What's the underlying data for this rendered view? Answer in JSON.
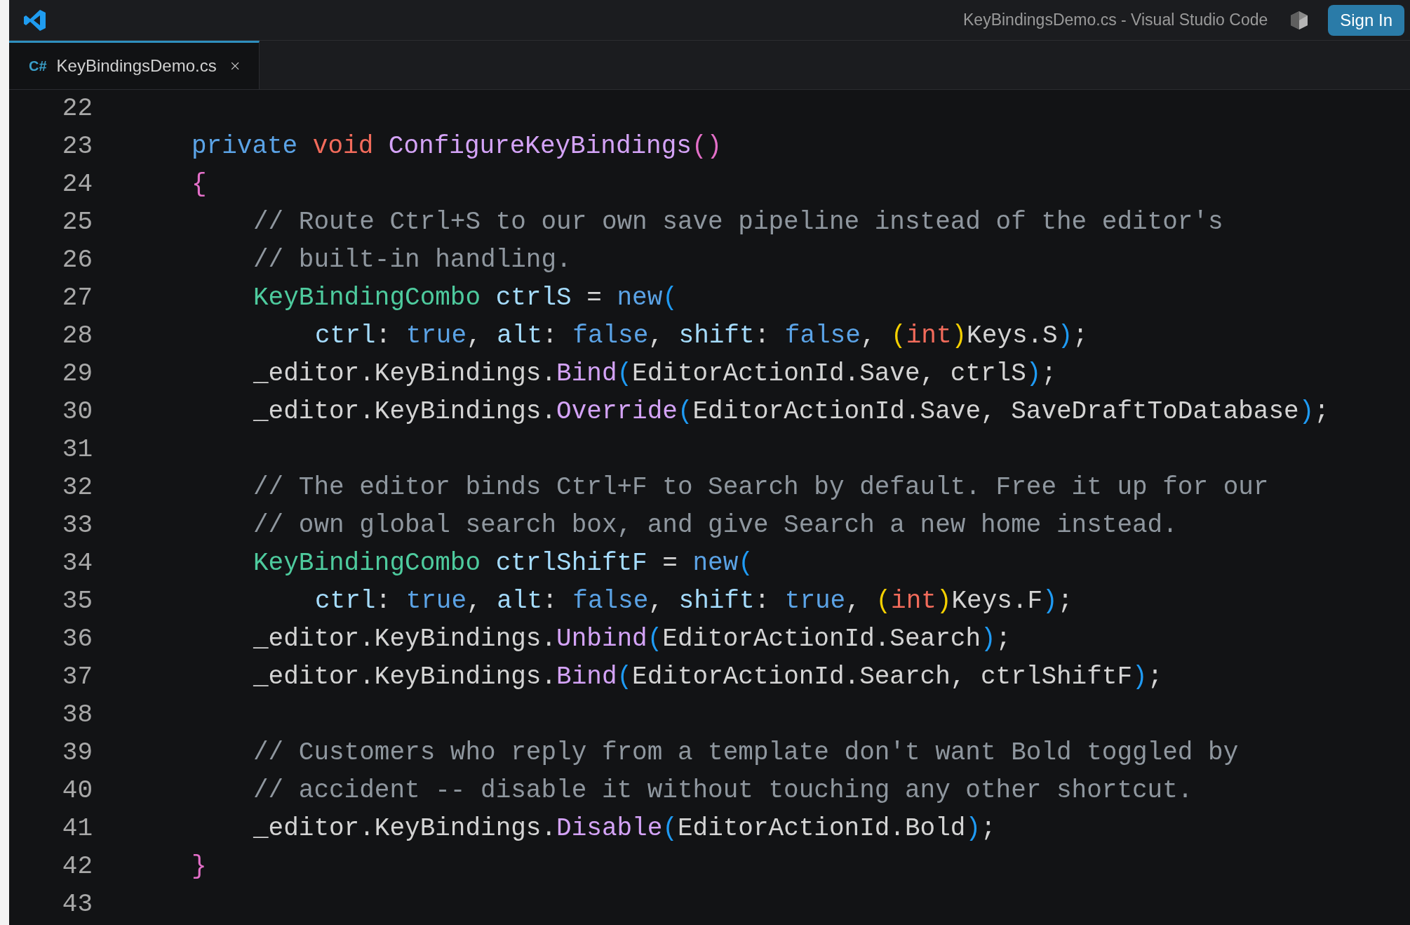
{
  "window": {
    "title": "KeyBindingsDemo.cs - Visual Studio Code",
    "sign_in": "Sign In"
  },
  "tabs": [
    {
      "label": "KeyBindingsDemo.cs",
      "icon": "C#",
      "selected": true
    }
  ],
  "editor": {
    "lines": [
      {
        "number": "22",
        "kind": "blank"
      },
      {
        "number": "23",
        "kind": "member",
        "tokens": [
          {
            "kind": "kw",
            "text": "private "
          },
          {
            "kind": "kw2",
            "text": "void "
          },
          {
            "kind": "fn",
            "text": "ConfigureKeyBindings"
          },
          {
            "kind": "b1",
            "text": "()"
          }
        ]
      },
      {
        "number": "24",
        "kind": "member",
        "tokens": [
          {
            "kind": "b1",
            "text": "{"
          }
        ]
      },
      {
        "number": "25",
        "kind": "body",
        "tokens": [
          {
            "kind": "comment",
            "text": "// Route Ctrl+S to our own save pipeline instead of the editor's"
          }
        ]
      },
      {
        "number": "26",
        "kind": "body",
        "tokens": [
          {
            "kind": "comment",
            "text": "// built-in handling."
          }
        ]
      },
      {
        "number": "27",
        "kind": "body",
        "tokens": [
          {
            "kind": "type",
            "text": "KeyBindingCombo "
          },
          {
            "kind": "var",
            "text": "ctrlS"
          },
          {
            "kind": "plain",
            "text": " = "
          },
          {
            "kind": "kw",
            "text": "new"
          },
          {
            "kind": "b2",
            "text": "("
          }
        ]
      },
      {
        "number": "28",
        "kind": "continuation",
        "tokens": [
          {
            "kind": "var",
            "text": "ctrl"
          },
          {
            "kind": "plain",
            "text": ": "
          },
          {
            "kind": "kw",
            "text": "true"
          },
          {
            "kind": "plain",
            "text": ", "
          },
          {
            "kind": "var",
            "text": "alt"
          },
          {
            "kind": "plain",
            "text": ": "
          },
          {
            "kind": "kw",
            "text": "false"
          },
          {
            "kind": "plain",
            "text": ", "
          },
          {
            "kind": "var",
            "text": "shift"
          },
          {
            "kind": "plain",
            "text": ": "
          },
          {
            "kind": "kw",
            "text": "false"
          },
          {
            "kind": "plain",
            "text": ", "
          },
          {
            "kind": "b3",
            "text": "("
          },
          {
            "kind": "kw2",
            "text": "int"
          },
          {
            "kind": "b3",
            "text": ")"
          },
          {
            "kind": "plain",
            "text": "Keys.S"
          },
          {
            "kind": "b2",
            "text": ")"
          },
          {
            "kind": "plain",
            "text": ";"
          }
        ]
      },
      {
        "number": "29",
        "kind": "body",
        "tokens": [
          {
            "kind": "plain",
            "text": "_editor.KeyBindings."
          },
          {
            "kind": "fn",
            "text": "Bind"
          },
          {
            "kind": "b2",
            "text": "("
          },
          {
            "kind": "plain",
            "text": "EditorActionId.Save, ctrlS"
          },
          {
            "kind": "b2",
            "text": ")"
          },
          {
            "kind": "plain",
            "text": ";"
          }
        ]
      },
      {
        "number": "30",
        "kind": "body",
        "tokens": [
          {
            "kind": "plain",
            "text": "_editor.KeyBindings."
          },
          {
            "kind": "fn",
            "text": "Override"
          },
          {
            "kind": "b2",
            "text": "("
          },
          {
            "kind": "plain",
            "text": "EditorActionId.Save, SaveDraftToDatabase"
          },
          {
            "kind": "b2",
            "text": ")"
          },
          {
            "kind": "plain",
            "text": ";"
          }
        ]
      },
      {
        "number": "31",
        "kind": "blank"
      },
      {
        "number": "32",
        "kind": "body",
        "tokens": [
          {
            "kind": "comment",
            "text": "// The editor binds Ctrl+F to Search by default. Free it up for our"
          }
        ]
      },
      {
        "number": "33",
        "kind": "body",
        "tokens": [
          {
            "kind": "comment",
            "text": "// own global search box, and give Search a new home instead."
          }
        ]
      },
      {
        "number": "34",
        "kind": "body",
        "tokens": [
          {
            "kind": "type",
            "text": "KeyBindingCombo "
          },
          {
            "kind": "var",
            "text": "ctrlShiftF"
          },
          {
            "kind": "plain",
            "text": " = "
          },
          {
            "kind": "kw",
            "text": "new"
          },
          {
            "kind": "b2",
            "text": "("
          }
        ]
      },
      {
        "number": "35",
        "kind": "continuation",
        "tokens": [
          {
            "kind": "var",
            "text": "ctrl"
          },
          {
            "kind": "plain",
            "text": ": "
          },
          {
            "kind": "kw",
            "text": "true"
          },
          {
            "kind": "plain",
            "text": ", "
          },
          {
            "kind": "var",
            "text": "alt"
          },
          {
            "kind": "plain",
            "text": ": "
          },
          {
            "kind": "kw",
            "text": "false"
          },
          {
            "kind": "plain",
            "text": ", "
          },
          {
            "kind": "var",
            "text": "shift"
          },
          {
            "kind": "plain",
            "text": ": "
          },
          {
            "kind": "kw",
            "text": "true"
          },
          {
            "kind": "plain",
            "text": ", "
          },
          {
            "kind": "b3",
            "text": "("
          },
          {
            "kind": "kw2",
            "text": "int"
          },
          {
            "kind": "b3",
            "text": ")"
          },
          {
            "kind": "plain",
            "text": "Keys.F"
          },
          {
            "kind": "b2",
            "text": ")"
          },
          {
            "kind": "plain",
            "text": ";"
          }
        ]
      },
      {
        "number": "36",
        "kind": "body",
        "tokens": [
          {
            "kind": "plain",
            "text": "_editor.KeyBindings."
          },
          {
            "kind": "fn",
            "text": "Unbind"
          },
          {
            "kind": "b2",
            "text": "("
          },
          {
            "kind": "plain",
            "text": "EditorActionId.Search"
          },
          {
            "kind": "b2",
            "text": ")"
          },
          {
            "kind": "plain",
            "text": ";"
          }
        ]
      },
      {
        "number": "37",
        "kind": "body",
        "tokens": [
          {
            "kind": "plain",
            "text": "_editor.KeyBindings."
          },
          {
            "kind": "fn",
            "text": "Bind"
          },
          {
            "kind": "b2",
            "text": "("
          },
          {
            "kind": "plain",
            "text": "EditorActionId.Search, ctrlShiftF"
          },
          {
            "kind": "b2",
            "text": ")"
          },
          {
            "kind": "plain",
            "text": ";"
          }
        ]
      },
      {
        "number": "38",
        "kind": "blank"
      },
      {
        "number": "39",
        "kind": "body",
        "tokens": [
          {
            "kind": "comment",
            "text": "// Customers who reply from a template don't want Bold toggled by"
          }
        ]
      },
      {
        "number": "40",
        "kind": "body",
        "tokens": [
          {
            "kind": "comment",
            "text": "// accident -- disable it without touching any other shortcut."
          }
        ]
      },
      {
        "number": "41",
        "kind": "body",
        "tokens": [
          {
            "kind": "plain",
            "text": "_editor.KeyBindings."
          },
          {
            "kind": "fn",
            "text": "Disable"
          },
          {
            "kind": "b2",
            "text": "("
          },
          {
            "kind": "plain",
            "text": "EditorActionId.Bold"
          },
          {
            "kind": "b2",
            "text": ")"
          },
          {
            "kind": "plain",
            "text": ";"
          }
        ]
      },
      {
        "number": "42",
        "kind": "member",
        "tokens": [
          {
            "kind": "b1",
            "text": "}"
          }
        ]
      },
      {
        "number": "43",
        "kind": "blank"
      }
    ]
  }
}
